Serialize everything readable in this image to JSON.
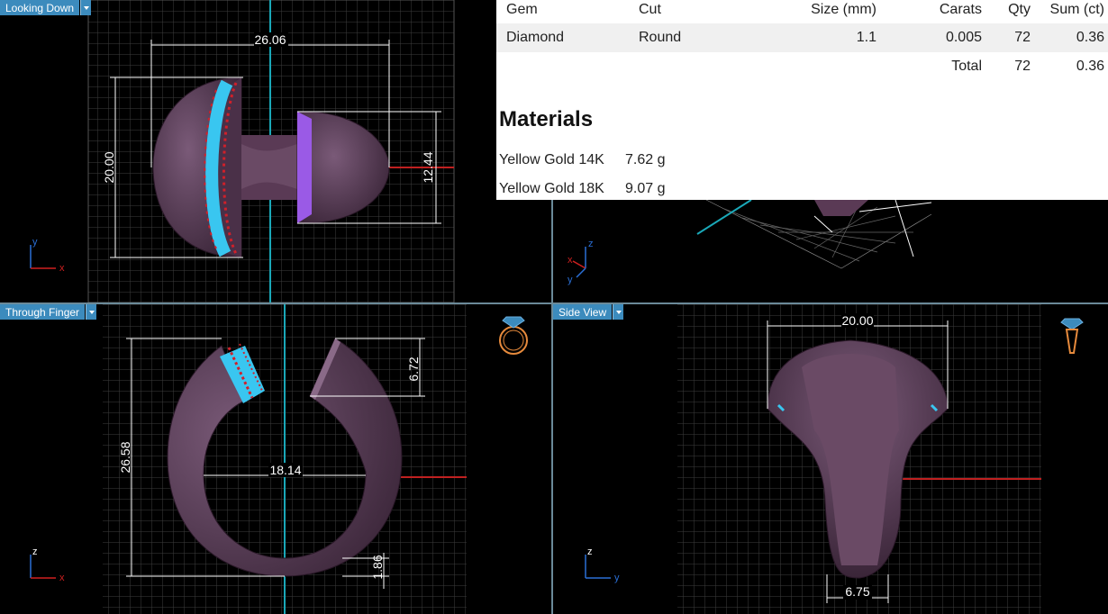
{
  "viewports": {
    "top_left": {
      "label": "Looking Down"
    },
    "bottom_left": {
      "label": "Through Finger"
    },
    "bottom_right": {
      "label": "Side View"
    }
  },
  "dimensions": {
    "top_width": "26.06",
    "top_height": "20.00",
    "top_right_height": "12.44",
    "finger_height": "26.58",
    "finger_inner": "18.14",
    "finger_gap": "6.72",
    "finger_bottom": "1.86",
    "side_top": "20.00",
    "side_bottom": "6.75"
  },
  "axes": {
    "tl": {
      "vertical": "y",
      "horizontal": "x"
    },
    "tr": {
      "vertical": "z",
      "left": "x",
      "bottom": "y"
    },
    "bl": {
      "vertical": "z",
      "horizontal": "x"
    },
    "br": {
      "vertical": "z",
      "horizontal": "y"
    }
  },
  "gem_table": {
    "headers": {
      "gem": "Gem",
      "cut": "Cut",
      "size": "Size (mm)",
      "carats": "Carats",
      "qty": "Qty",
      "sum": "Sum (ct)"
    },
    "rows": [
      {
        "gem": "Diamond",
        "cut": "Round",
        "size": "1.1",
        "carats": "0.005",
        "qty": "72",
        "sum": "0.36"
      }
    ],
    "total": {
      "label": "Total",
      "qty": "72",
      "sum": "0.36"
    }
  },
  "materials": {
    "title": "Materials",
    "items": [
      {
        "name": "Yellow Gold 14K",
        "weight": "7.62 g"
      },
      {
        "name": "Yellow Gold 18K",
        "weight": "9.07 g"
      }
    ]
  },
  "colors": {
    "accent": "#3c8bbd",
    "ring": "#5a3a55",
    "gem_blue": "#39c6f0",
    "prong_red": "#d0202a",
    "gem_purple": "#9a5ae6",
    "grid": "#4a4a4a"
  }
}
